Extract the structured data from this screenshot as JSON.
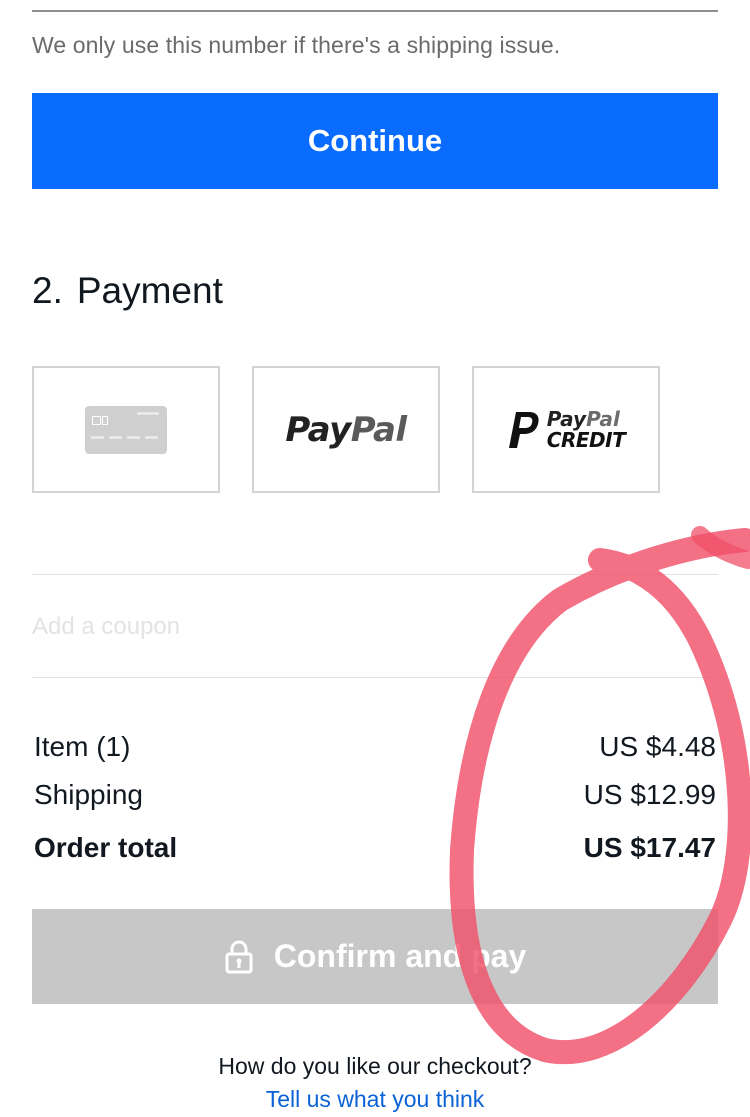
{
  "contact": {
    "helper_text": "We only use this number if there's a shipping issue.",
    "continue_label": "Continue"
  },
  "payment": {
    "step_number": "2.",
    "title": "Payment",
    "options": [
      {
        "name": "card",
        "icon": "credit-card-icon"
      },
      {
        "name": "paypal",
        "logo_pay": "Pay",
        "logo_pal": "Pal"
      },
      {
        "name": "paypal-credit",
        "logo_pay": "Pay",
        "logo_pal": "Pal",
        "logo_credit": "CREDIT"
      }
    ]
  },
  "coupon": {
    "label": "Add a coupon"
  },
  "summary": {
    "item_label": "Item (1)",
    "item_value": "US $4.48",
    "shipping_label": "Shipping",
    "shipping_value": "US $12.99",
    "total_label": "Order total",
    "total_value": "US $17.47"
  },
  "confirm": {
    "label": "Confirm and pay",
    "icon": "lock-icon"
  },
  "feedback": {
    "question": "How do you like our checkout?",
    "link": "Tell us what you think"
  },
  "colors": {
    "primary": "#0a6cff",
    "disabled": "#c7c7c7",
    "link": "#0a62d6",
    "annotation": "#f0506a"
  }
}
